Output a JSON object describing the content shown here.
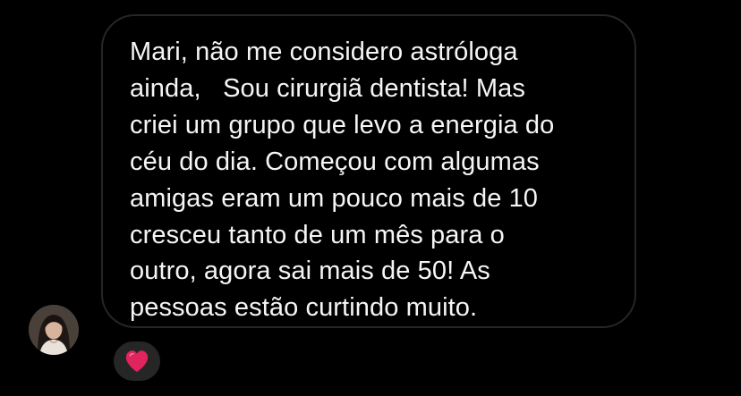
{
  "message": {
    "lines": [
      "Mari, não me considero astróloga",
      "ainda,   Sou cirurgiã dentista! Mas",
      "criei um grupo que levo a energia do",
      "céu do dia. Começou com algumas",
      "amigas eram um pouco mais de 10",
      "cresceu tanto de um mês para o",
      "outro, agora sai mais de 50! As",
      "pessoas estão curtindo muito."
    ]
  },
  "reaction": {
    "icon": "heart-icon",
    "color": "#e0245e"
  },
  "avatar": {
    "icon": "user-avatar"
  },
  "colors": {
    "background": "#000000",
    "bubble_border": "#262626",
    "text": "#f5f5f5",
    "reaction_background": "#262626"
  }
}
